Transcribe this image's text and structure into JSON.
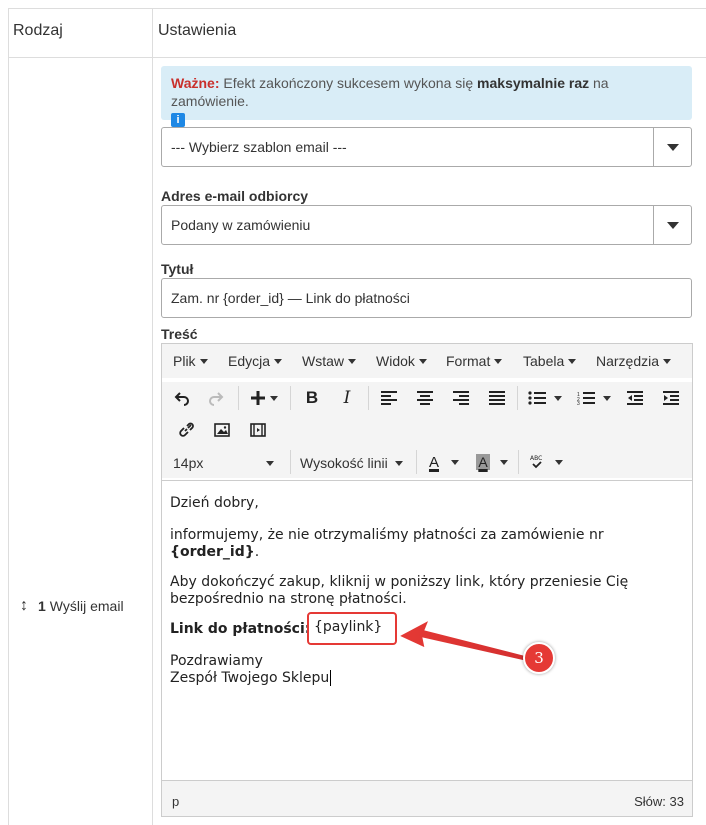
{
  "table": {
    "col_type_header": "Rodzaj",
    "col_settings_header": "Ustawienia"
  },
  "action": {
    "number": "1",
    "label": "Wyślij email"
  },
  "alert": {
    "prefix": "Ważne:",
    "text1": "Efekt zakończony sukcesem wykona się",
    "strong": "maksymalnie raz",
    "text2": "na zamówienie.",
    "info_icon": "i"
  },
  "template_select": {
    "value": "--- Wybierz szablon email ---"
  },
  "recipient": {
    "label": "Adres e-mail odbiorcy",
    "value": "Podany w zamówieniu"
  },
  "title_field": {
    "label": "Tytuł",
    "value": "Zam. nr {order_id} — Link do płatności"
  },
  "content_label": "Treść",
  "editor": {
    "menus": [
      "Plik",
      "Edycja",
      "Wstaw",
      "Widok",
      "Format",
      "Tabela",
      "Narzędzia"
    ],
    "font_size": "14px",
    "line_height_label": "Wysokość linii",
    "body": {
      "p1": "Dzień dobry,",
      "p2_text": "informujemy, że nie otrzymaliśmy płatności za zamówienie nr",
      "p2_bold": "{order_id}",
      "p2_end": ".",
      "p3": "Aby dokończyć zakup, kliknij w poniższy link, który przeniesie Cię bezpośrednio na stronę płatności.",
      "p4_bold": "Link do płatności:",
      "p4_link": "{paylink}",
      "p5_line1": "Pozdrawiamy",
      "p5_line2": "Zespół Twojego Sklepu"
    },
    "status_path": "p",
    "word_count": "Słów: 33"
  },
  "annotation": {
    "badge": "3",
    "color": "#e53935"
  },
  "icons": [
    "undo-icon",
    "redo-icon",
    "plus-icon",
    "bold-icon",
    "italic-icon",
    "align-left-icon",
    "align-center-icon",
    "align-right-icon",
    "align-justify-icon",
    "bullet-list-icon",
    "numbered-list-icon",
    "outdent-icon",
    "indent-icon",
    "link-icon",
    "image-icon",
    "media-icon",
    "text-color-icon",
    "highlight-icon",
    "spellcheck-icon"
  ]
}
